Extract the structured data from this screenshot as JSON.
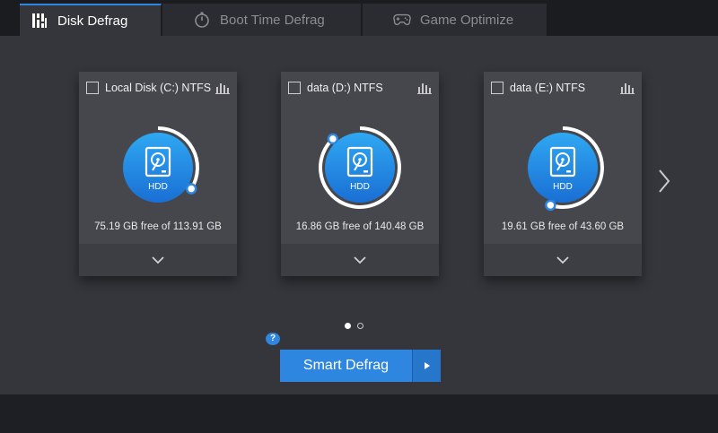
{
  "tabs": [
    {
      "label": "Disk Defrag",
      "icon": "disk-defrag-icon",
      "active": true
    },
    {
      "label": "Boot Time Defrag",
      "icon": "stopwatch-icon",
      "active": false
    },
    {
      "label": "Game Optimize",
      "icon": "gamepad-icon",
      "active": false
    }
  ],
  "disks": [
    {
      "title": "Local Disk (C:) NTFS",
      "type": "HDD",
      "free_text": "75.19 GB free of 113.91 GB",
      "free_gb": 75.19,
      "total_gb": 113.91
    },
    {
      "title": "data (D:) NTFS",
      "type": "HDD",
      "free_text": "16.86 GB free of 140.48 GB",
      "free_gb": 16.86,
      "total_gb": 140.48
    },
    {
      "title": "data (E:) NTFS",
      "type": "HDD",
      "free_text": "19.61 GB free of 43.60 GB",
      "free_gb": 19.61,
      "total_gb": 43.6
    }
  ],
  "pagination": {
    "current_page": 1,
    "page_count": 2
  },
  "help": {
    "label": "?"
  },
  "action": {
    "label": "Smart Defrag"
  },
  "colors": {
    "accent": "#2f86e0",
    "disk_gradient_top": "#2fa8f2",
    "disk_gradient_bottom": "#1a6fd4",
    "card_bg": "#45474d",
    "main_bg": "#34363c"
  }
}
